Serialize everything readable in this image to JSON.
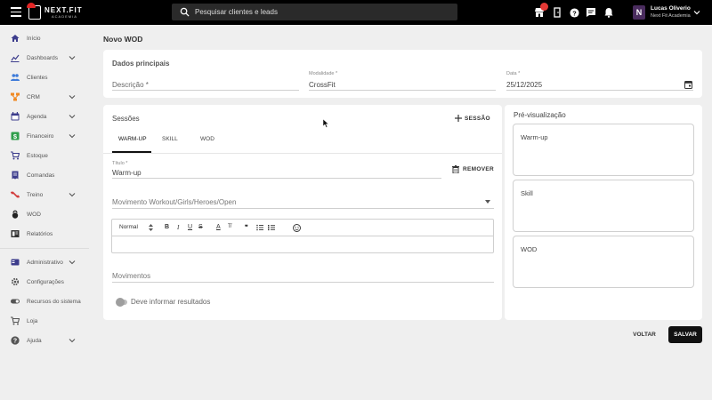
{
  "topbar": {
    "logo_text": "NEXT.FIT",
    "logo_sub": "ACADEMIA",
    "search_placeholder": "Pesquisar clientes e leads",
    "user_initial": "N",
    "user_name": "Lucas Oliverio",
    "user_org": "Next Fit Academia",
    "icons": [
      "store-icon",
      "exit-door-icon",
      "help-icon",
      "chat-icon",
      "bell-icon"
    ]
  },
  "sidebar": {
    "items": [
      {
        "label": "Início",
        "icon": "home-icon",
        "chevron": false
      },
      {
        "label": "Dashboards",
        "icon": "chart-icon",
        "chevron": true
      },
      {
        "label": "Clientes",
        "icon": "people-icon",
        "chevron": false
      },
      {
        "label": "CRM",
        "icon": "hierarchy-icon",
        "chevron": true
      },
      {
        "label": "Agenda",
        "icon": "calendar-icon",
        "chevron": true
      },
      {
        "label": "Financeiro",
        "icon": "money-icon",
        "chevron": true
      },
      {
        "label": "Estoque",
        "icon": "cart-icon",
        "chevron": false
      },
      {
        "label": "Comandas",
        "icon": "receipt-icon",
        "chevron": false
      },
      {
        "label": "Treino",
        "icon": "dumbbell-icon",
        "chevron": true
      },
      {
        "label": "WOD",
        "icon": "kettlebell-icon",
        "chevron": false
      },
      {
        "label": "Relatórios",
        "icon": "report-icon",
        "chevron": false
      },
      {
        "label": "Administrativo",
        "icon": "id-card-icon",
        "chevron": true
      },
      {
        "label": "Configurações",
        "icon": "gear-icon",
        "chevron": false
      },
      {
        "label": "Recursos do sistema",
        "icon": "toggle-icon",
        "chevron": false
      },
      {
        "label": "Loja",
        "icon": "cart-icon",
        "chevron": false
      },
      {
        "label": "Ajuda",
        "icon": "help-icon",
        "chevron": true
      }
    ]
  },
  "page": {
    "title": "Novo WOD"
  },
  "dados": {
    "title": "Dados principais",
    "descricao_label": "Descrição *",
    "modalidade_label": "Modalidade *",
    "modalidade_value": "CrossFit",
    "data_label": "Data *",
    "data_value": "25/12/2025"
  },
  "sessoes": {
    "title": "Sessões",
    "add_label": "SESSÃO",
    "tabs": [
      "WARM-UP",
      "SKILL",
      "WOD"
    ],
    "titulo_label": "Título *",
    "titulo_value": "Warm-up",
    "remove_label": "REMOVER",
    "movimento_placeholder": "Movimento Workout/Girls/Heroes/Open",
    "editor_format": "Normal",
    "movimentos_placeholder": "Movimentos",
    "toggle_label": "Deve informar resultados"
  },
  "preview": {
    "title": "Pré-visualização",
    "boxes": [
      "Warm-up",
      "Skill",
      "WOD"
    ]
  },
  "actions": {
    "back_label": "VOLTAR",
    "save_label": "SALVAR"
  }
}
